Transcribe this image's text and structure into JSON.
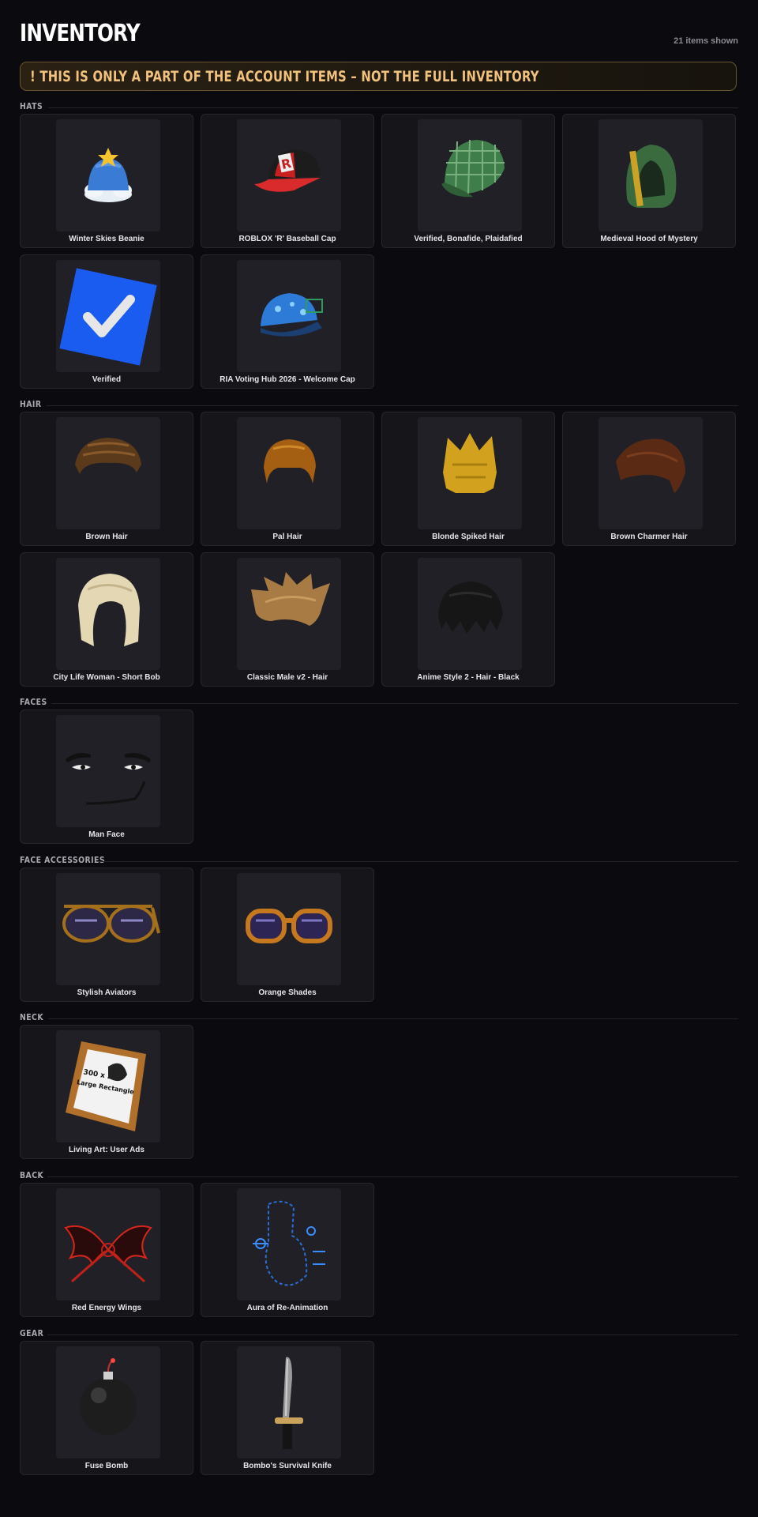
{
  "header": {
    "title": "INVENTORY",
    "count": "21 items shown"
  },
  "banner": {
    "text": "! THIS IS ONLY A PART OF THE ACCOUNT ITEMS – NOT THE FULL INVENTORY"
  },
  "sections": [
    {
      "title": "HATS",
      "items": [
        {
          "name": "Winter Skies Beanie",
          "icon": "beanie-icon"
        },
        {
          "name": "ROBLOX 'R' Baseball Cap",
          "icon": "baseball-cap-icon"
        },
        {
          "name": "Verified, Bonafide, Plaidafied",
          "icon": "plaid-cap-icon"
        },
        {
          "name": "Medieval Hood of Mystery",
          "icon": "hood-icon"
        },
        {
          "name": "Verified",
          "icon": "verified-check-icon"
        },
        {
          "name": "RIA Voting Hub 2026 - Welcome Cap",
          "icon": "blue-cap-icon"
        }
      ]
    },
    {
      "title": "HAIR",
      "items": [
        {
          "name": "Brown Hair",
          "icon": "hair-icon"
        },
        {
          "name": "Pal Hair",
          "icon": "hair-icon"
        },
        {
          "name": "Blonde Spiked Hair",
          "icon": "spiked-hair-icon"
        },
        {
          "name": "Brown Charmer Hair",
          "icon": "hair-icon"
        },
        {
          "name": "City Life Woman - Short Bob",
          "icon": "bob-hair-icon"
        },
        {
          "name": "Classic Male v2 - Hair",
          "icon": "hair-icon"
        },
        {
          "name": "Anime Style 2 - Hair - Black",
          "icon": "hair-icon"
        }
      ]
    },
    {
      "title": "FACES",
      "items": [
        {
          "name": "Man Face",
          "icon": "face-icon"
        }
      ]
    },
    {
      "title": "FACE ACCESSORIES",
      "items": [
        {
          "name": "Stylish Aviators",
          "icon": "aviators-icon"
        },
        {
          "name": "Orange Shades",
          "icon": "shades-icon"
        }
      ]
    },
    {
      "title": "NECK",
      "items": [
        {
          "name": "Living Art: User Ads",
          "icon": "picture-frame-icon"
        }
      ]
    },
    {
      "title": "BACK",
      "items": [
        {
          "name": "Red Energy Wings",
          "icon": "wings-icon"
        },
        {
          "name": "Aura of Re-Animation",
          "icon": "aura-icon"
        }
      ]
    },
    {
      "title": "GEAR",
      "items": [
        {
          "name": "Fuse Bomb",
          "icon": "bomb-icon"
        },
        {
          "name": "Bombo's Survival Knife",
          "icon": "knife-icon"
        }
      ]
    }
  ],
  "frame_art": {
    "line1": "300 x 250",
    "line2": "Large Rectangle"
  }
}
